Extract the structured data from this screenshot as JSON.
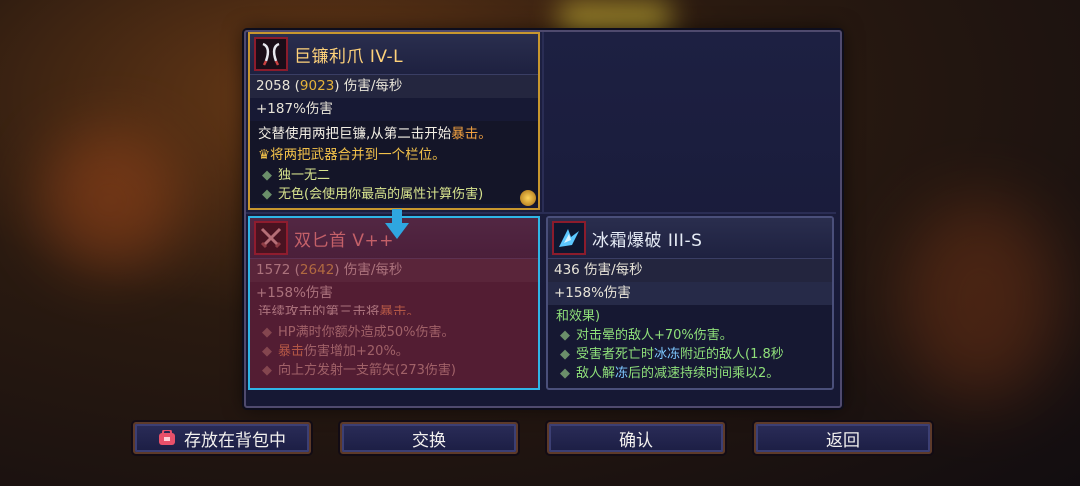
{
  "weapon_giant": {
    "name": "巨镰利爪 IV-L",
    "dps_base": "2058",
    "dps_high": "9023",
    "dps_unit": "伤害/每秒",
    "bonus": "+187%伤害",
    "desc_main": "交替使用两把巨镰,从第二击开始",
    "desc_crit": "暴击。",
    "merge_text": "将两把武器合并到一个栏位。",
    "traits": [
      "独一无二",
      "无色(会使用你最高的属性计算伤害)"
    ]
  },
  "weapon_dual": {
    "name": "双匕首 V++",
    "dps_base": "1572",
    "dps_high": "2642",
    "dps_unit": "伤害/每秒",
    "bonus": "+158%伤害",
    "desc_main": "连续攻击的第三击将",
    "desc_crit": "暴击。",
    "traits_a": "HP满时你额外造成50%伤害。",
    "traits_b_crit": "暴击",
    "traits_b": "伤害增加+20%。",
    "traits_c": "向上方发射一支箭矢(273伤害)"
  },
  "weapon_ice": {
    "name": "冰霜爆破 III-S",
    "dps": "436",
    "dps_unit": "伤害/每秒",
    "bonus": "+158%伤害",
    "effect_head": "和效果)",
    "trait_1": "对击晕的敌人+70%伤害。",
    "trait_2_pre": "受害者死亡时",
    "trait_2_ice": "冰冻",
    "trait_2_post": "附近的敌人(1.8秒",
    "trait_3_pre": "敌人解",
    "trait_3_ice": "冻",
    "trait_3_post": "后的减速持续时间乘以2。"
  },
  "buttons": {
    "store": "存放在背包中",
    "swap": "交换",
    "confirm": "确认",
    "back": "返回"
  },
  "colors": {
    "gold_border": "#c8972e",
    "select_border": "#2fb5e6",
    "crit": "#f0a040",
    "ice": "#7dc7ff"
  },
  "icons": [
    "scythe-claw-icon",
    "dual-daggers-icon",
    "ice-blast-icon",
    "swap-arrow-icon",
    "backpack-icon",
    "crown-icon"
  ]
}
